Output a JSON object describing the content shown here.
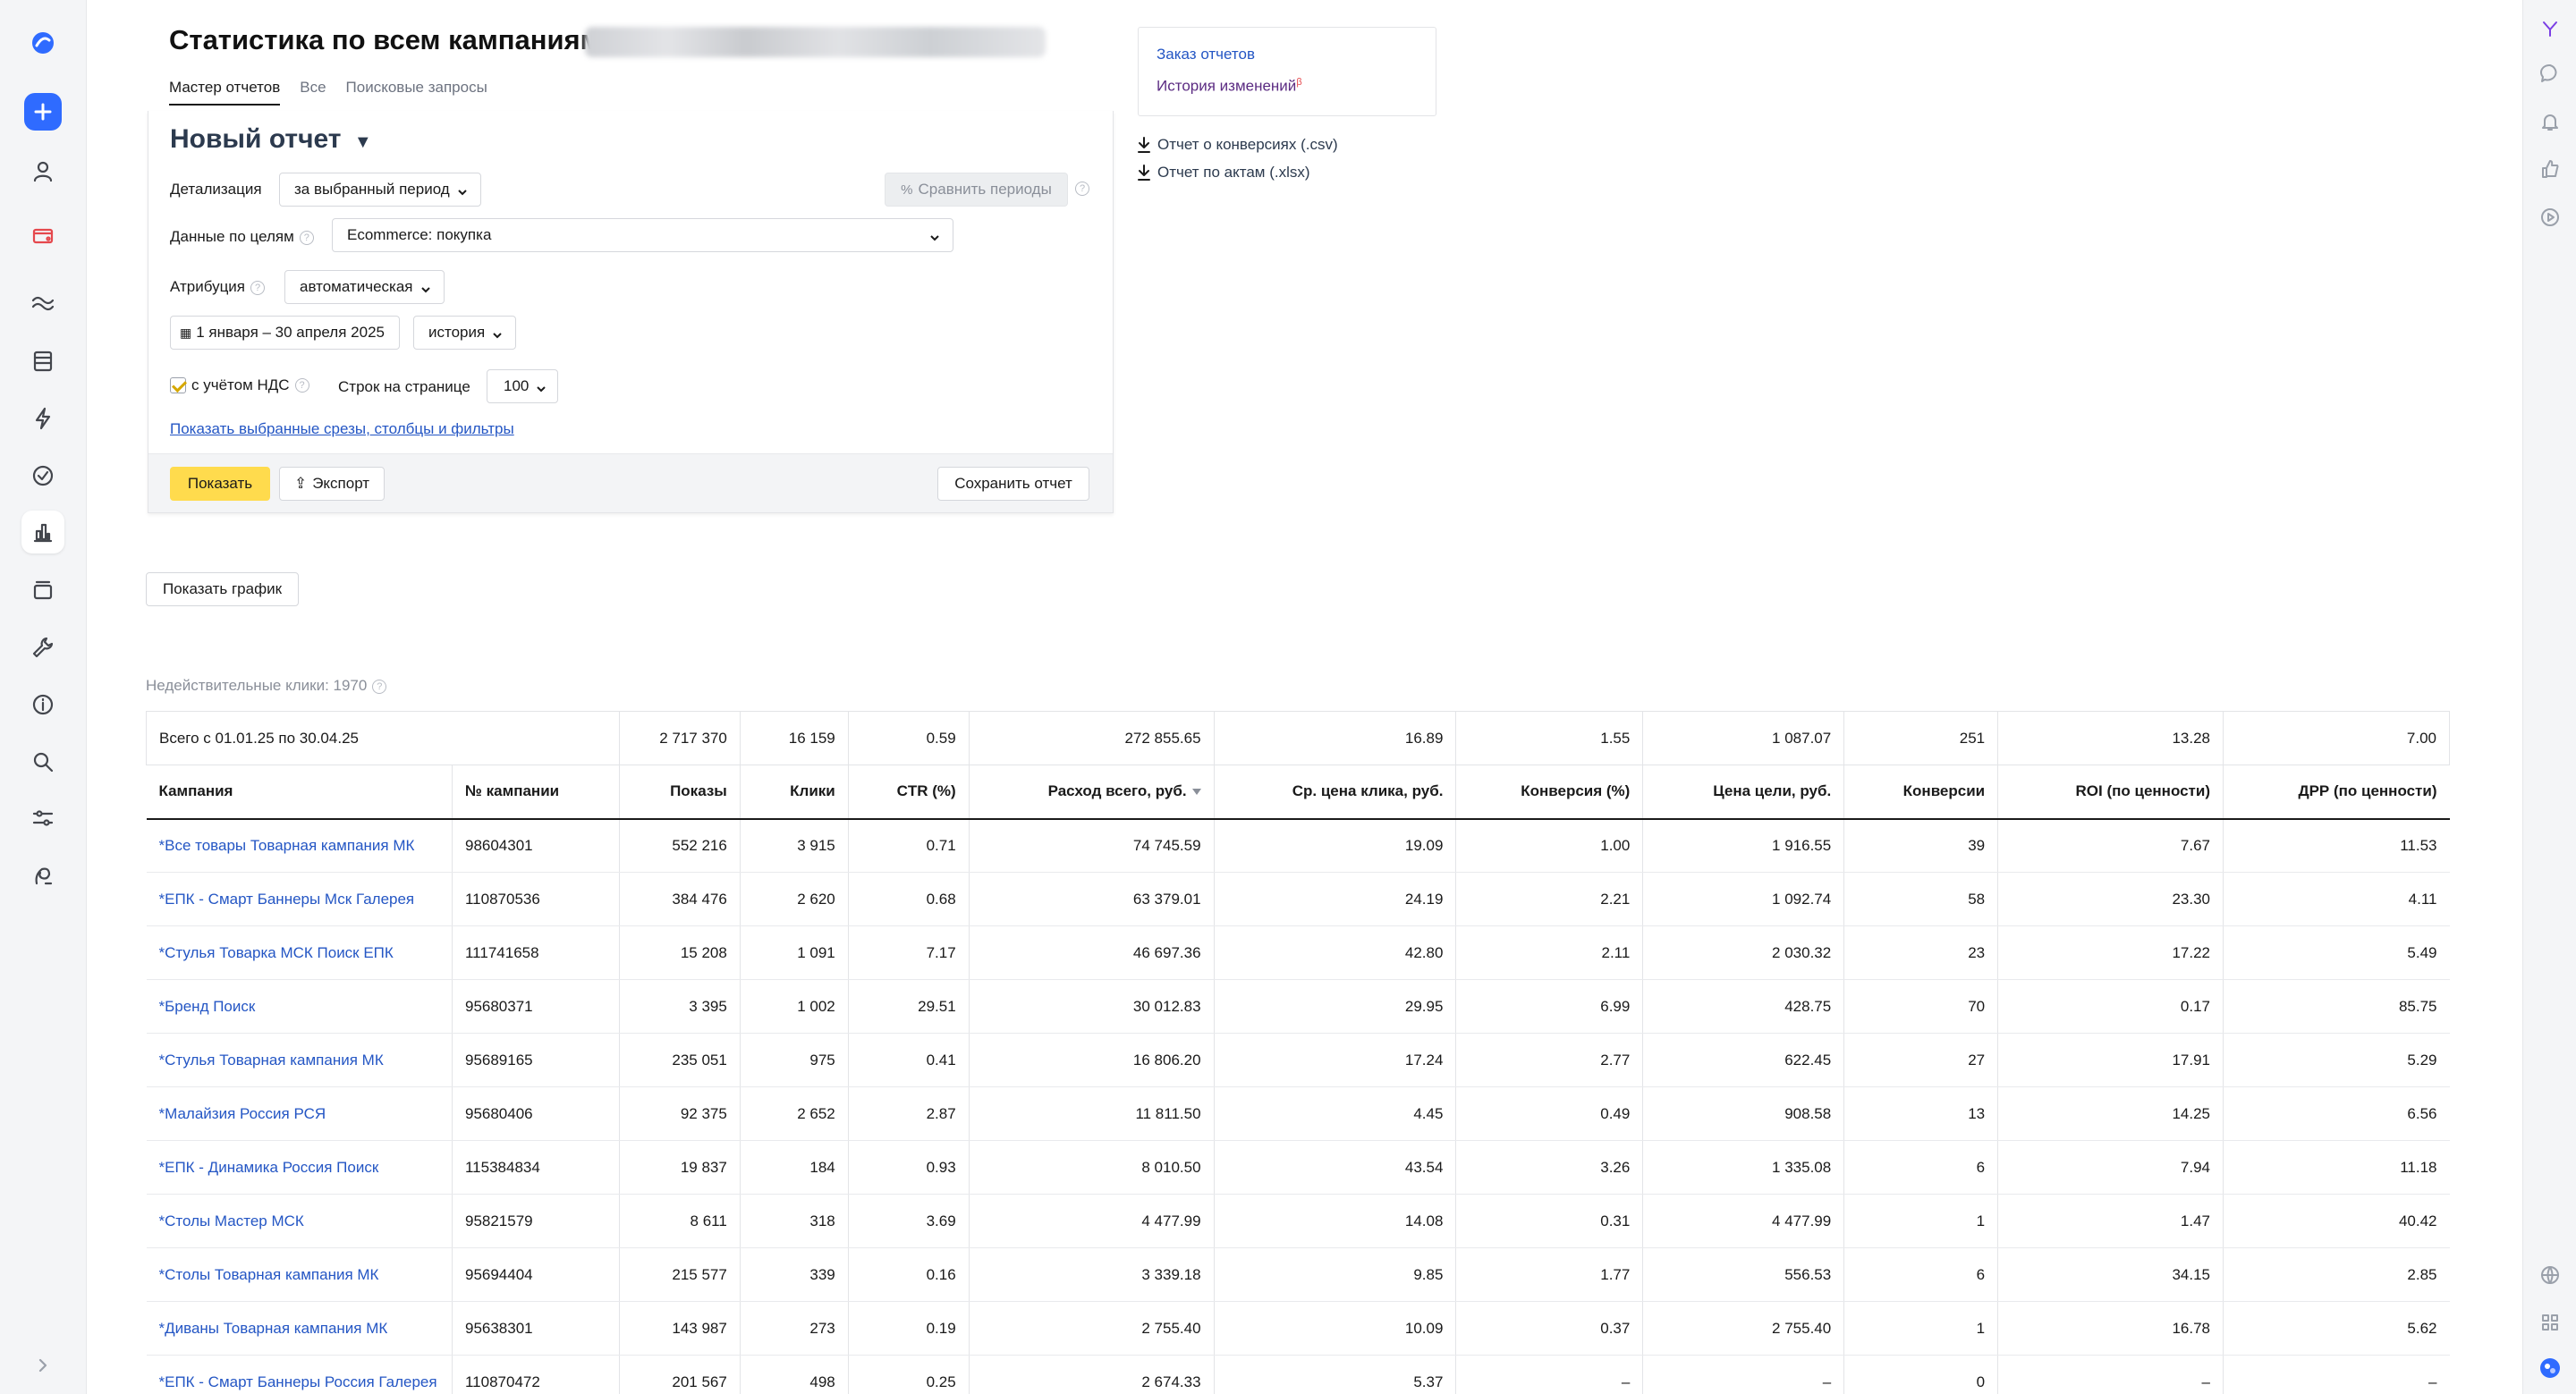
{
  "header": {
    "title": "Статистика по всем кампаниям:",
    "tabs": [
      "Мастер отчетов",
      "Все",
      "Поисковые запросы"
    ]
  },
  "form": {
    "report_name": "Новый отчет",
    "detalization_label": "Детализация",
    "detalization_value": "за выбранный период",
    "compare_periods": "Сравнить периоды",
    "goals_label": "Данные по целям",
    "goals_value": "Ecommerce: покупка",
    "attribution_label": "Атрибуция",
    "attribution_value": "автоматическая",
    "date_range": "1 января – 30 апреля 2025",
    "history_value": "история",
    "vat_label": "с учётом НДС",
    "vat_checked": true,
    "rows_label": "Строк на странице",
    "rows_value": "100",
    "show_filters_link": "Показать выбранные срезы, столбцы и фильтры",
    "show_button": "Показать",
    "export_button": "Экспорт",
    "save_button": "Сохранить отчет"
  },
  "side_links": {
    "order_reports": "Заказ отчетов",
    "change_history": "История изменений",
    "beta": "β",
    "conversions_csv": "Отчет о конверсиях (.csv)",
    "acts_xlsx": "Отчет по актам (.xlsx)"
  },
  "show_chart_button": "Показать график",
  "invalid_clicks": "Недействительные клики: 1970",
  "table": {
    "total": {
      "label": "Всего с 01.01.25 по 30.04.25",
      "values": [
        "2 717 370",
        "16 159",
        "0.59",
        "272 855.65",
        "16.89",
        "1.55",
        "1 087.07",
        "251",
        "13.28",
        "7.00"
      ]
    },
    "columns": [
      "Кампания",
      "№ кампании",
      "Показы",
      "Клики",
      "CTR (%)",
      "Расход всего, руб.",
      "Ср. цена клика, руб.",
      "Конверсия (%)",
      "Цена цели, руб.",
      "Конверсии",
      "ROI (по ценности)",
      "ДРР (по ценности)"
    ],
    "rows": [
      [
        "*Все товары Товарная кампания МК",
        "98604301",
        "552 216",
        "3 915",
        "0.71",
        "74 745.59",
        "19.09",
        "1.00",
        "1 916.55",
        "39",
        "7.67",
        "11.53"
      ],
      [
        "*ЕПК - Смарт Баннеры Мск Галерея",
        "110870536",
        "384 476",
        "2 620",
        "0.68",
        "63 379.01",
        "24.19",
        "2.21",
        "1 092.74",
        "58",
        "23.30",
        "4.11"
      ],
      [
        "*Стулья Товарка МСК Поиск ЕПК",
        "111741658",
        "15 208",
        "1 091",
        "7.17",
        "46 697.36",
        "42.80",
        "2.11",
        "2 030.32",
        "23",
        "17.22",
        "5.49"
      ],
      [
        "*Бренд Поиск",
        "95680371",
        "3 395",
        "1 002",
        "29.51",
        "30 012.83",
        "29.95",
        "6.99",
        "428.75",
        "70",
        "0.17",
        "85.75"
      ],
      [
        "*Стулья Товарная кампания МК",
        "95689165",
        "235 051",
        "975",
        "0.41",
        "16 806.20",
        "17.24",
        "2.77",
        "622.45",
        "27",
        "17.91",
        "5.29"
      ],
      [
        "*Малайзия Россия РСЯ",
        "95680406",
        "92 375",
        "2 652",
        "2.87",
        "11 811.50",
        "4.45",
        "0.49",
        "908.58",
        "13",
        "14.25",
        "6.56"
      ],
      [
        "*ЕПК - Динамика Россия Поиск",
        "115384834",
        "19 837",
        "184",
        "0.93",
        "8 010.50",
        "43.54",
        "3.26",
        "1 335.08",
        "6",
        "7.94",
        "11.18"
      ],
      [
        "*Столы Мастер МСК",
        "95821579",
        "8 611",
        "318",
        "3.69",
        "4 477.99",
        "14.08",
        "0.31",
        "4 477.99",
        "1",
        "1.47",
        "40.42"
      ],
      [
        "*Столы Товарная кампания МК",
        "95694404",
        "215 577",
        "339",
        "0.16",
        "3 339.18",
        "9.85",
        "1.77",
        "556.53",
        "6",
        "34.15",
        "2.85"
      ],
      [
        "*Диваны Товарная кампания МК",
        "95638301",
        "143 987",
        "273",
        "0.19",
        "2 755.40",
        "10.09",
        "0.37",
        "2 755.40",
        "1",
        "16.78",
        "5.62"
      ],
      [
        "*ЕПК - Смарт Баннеры Россия Галерея",
        "110870472",
        "201 567",
        "498",
        "0.25",
        "2 674.33",
        "5.37",
        "–",
        "–",
        "0",
        "–",
        "–"
      ]
    ]
  },
  "colors": {
    "accent_yellow": "#ffdb4d",
    "link_blue": "#2456c4",
    "plus_blue": "#2f6bff"
  },
  "left_sidebar_icons": [
    "direct-logo-icon",
    "plus-icon",
    "user-icon",
    "campaign-icon",
    "wave-icon",
    "database-icon",
    "lightning-icon",
    "check-circle-icon",
    "bar-chart-icon",
    "layers-icon",
    "wrench-icon",
    "info-icon",
    "search-icon",
    "sliders-icon",
    "tools-icon",
    "expand-icon"
  ],
  "right_sidebar_icons": [
    "yandex-logo-icon",
    "chat-icon",
    "bell-icon",
    "thumbs-up-icon",
    "play-icon",
    "globe-icon",
    "apps-grid-icon",
    "assistant-icon"
  ]
}
